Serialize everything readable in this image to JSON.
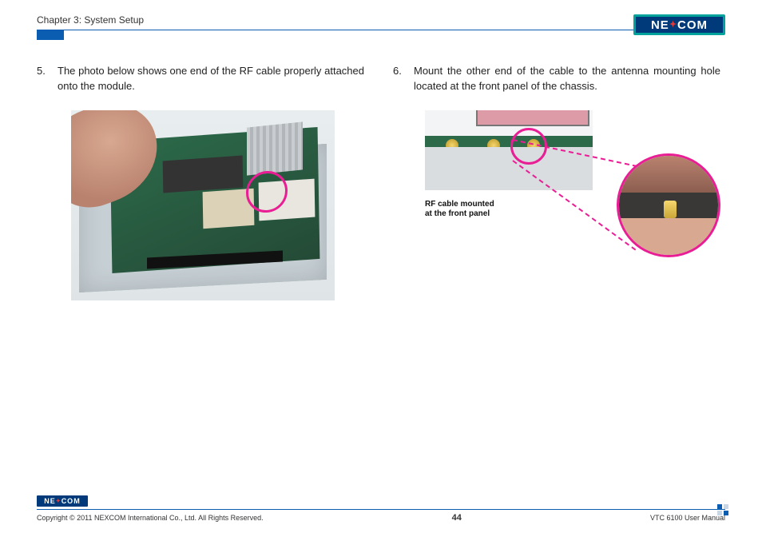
{
  "header": {
    "chapter": "Chapter 3: System Setup",
    "logo_text": "NEXCOM"
  },
  "left": {
    "step_number": "5.",
    "step_text": "The photo below shows one end of the RF cable properly attached onto the module."
  },
  "right": {
    "step_number": "6.",
    "step_text": "Mount the other end of the cable to the antenna mounting hole located at the front panel of the chassis.",
    "callout_line1": "RF cable mounted",
    "callout_line2": "at the front panel"
  },
  "footer": {
    "logo_text": "NEXCOM",
    "copyright": "Copyright © 2011 NEXCOM International Co., Ltd. All Rights Reserved.",
    "page_number": "44",
    "doc_title": "VTC 6100 User Manual"
  }
}
